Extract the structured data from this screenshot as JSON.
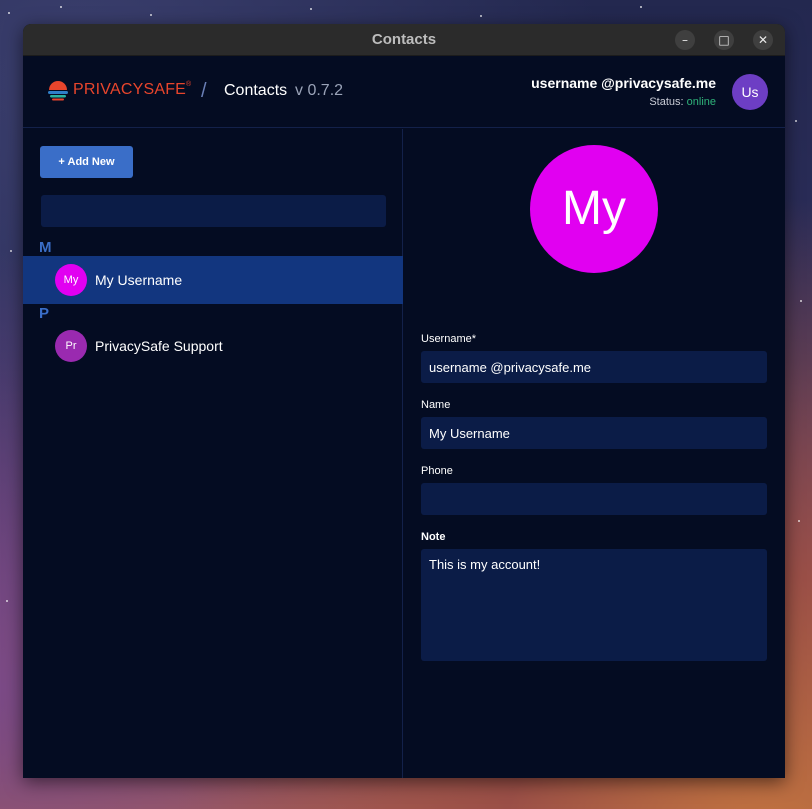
{
  "window": {
    "title": "Contacts",
    "controls": {
      "minimize": "–",
      "maximize": "□",
      "close": "✕"
    }
  },
  "header": {
    "logo_text": "PRIVACYSAFE",
    "logo_mark": "®",
    "separator": "/",
    "breadcrumb": "Contacts",
    "version": "v 0.7.2",
    "user": {
      "name": "username @privacysafe.me",
      "status_label": "Status:",
      "status_value": "online",
      "avatar_initials": "Us",
      "avatar_color": "#6d3ec4"
    }
  },
  "sidebar": {
    "add_button": "+ Add New",
    "search": {
      "value": "",
      "placeholder": ""
    },
    "groups": [
      {
        "letter": "M",
        "contacts": [
          {
            "initials": "My",
            "name": "My Username",
            "color": "#e100f1",
            "selected": true
          }
        ]
      },
      {
        "letter": "P",
        "contacts": [
          {
            "initials": "Pr",
            "name": "PrivacySafe Support",
            "color": "#9a2ab0",
            "selected": false
          }
        ]
      }
    ]
  },
  "detail": {
    "avatar_initials": "My",
    "avatar_color": "#e100f1",
    "fields": {
      "username": {
        "label": "Username*",
        "value": "username @privacysafe.me"
      },
      "name": {
        "label": "Name",
        "value": "My Username"
      },
      "phone": {
        "label": "Phone",
        "value": ""
      },
      "note": {
        "label": "Note",
        "value": "This is my account!"
      }
    }
  },
  "colors": {
    "accent": "#3a6ec8",
    "brand": "#e8452c",
    "status_online": "#2fb37a",
    "selected_row": "#12367f",
    "background": "#040c22"
  }
}
